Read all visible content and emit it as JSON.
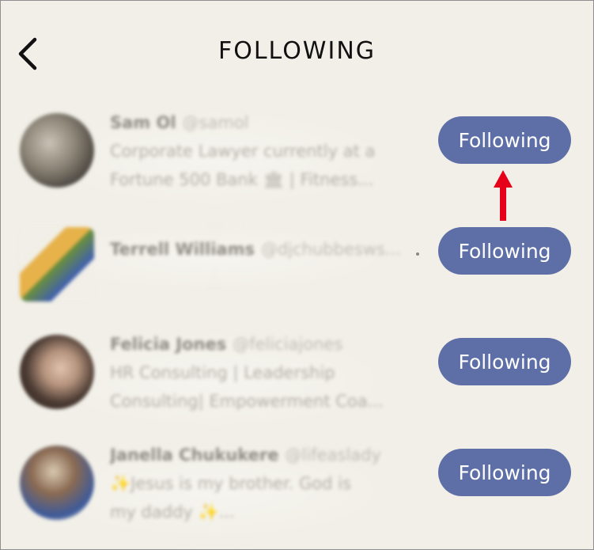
{
  "header": {
    "title": "FOLLOWING",
    "back_icon": "chevron-left-icon"
  },
  "following_list": [
    {
      "name": "Sam Ol",
      "handle": "@samol",
      "bio_lines": [
        "Corporate Lawyer currently at a",
        "Fortune 500 Bank 🏛 | Fitness..."
      ],
      "button_label": "Following"
    },
    {
      "name": "Terrell Williams",
      "handle": "@djchubbesws...",
      "bio_lines": [],
      "button_label": "Following"
    },
    {
      "name": "Felicia Jones",
      "handle": "@feliciajones",
      "bio_lines": [
        "HR Consulting | Leadership",
        "Consulting| Empowerment Coa..."
      ],
      "button_label": "Following"
    },
    {
      "name": "Janella Chukukere",
      "handle": "@lifeaslady",
      "bio_lines": [
        "✨Jesus is my brother. God is",
        "my daddy ✨..."
      ],
      "button_label": "Following"
    }
  ],
  "annotation": {
    "arrow_color": "#e6001a"
  },
  "colors": {
    "background": "#f1efe7",
    "button": "#5d6fa6"
  }
}
